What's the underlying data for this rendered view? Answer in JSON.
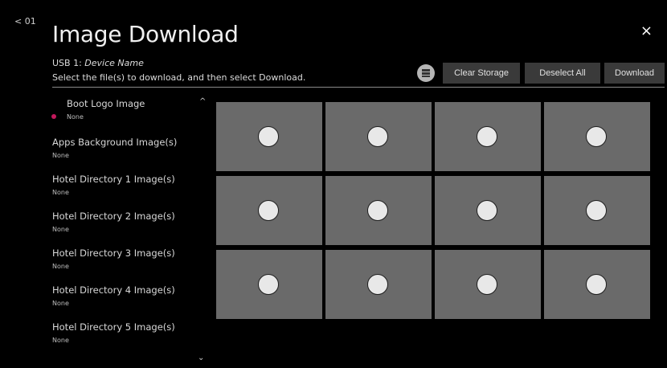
{
  "header": {
    "back_label": "< 01",
    "title": "Image Download",
    "close_glyph": "×",
    "usb_prefix": "USB 1: ",
    "usb_device": "Device Name",
    "instruction": "Select the file(s) to download, and then select Download."
  },
  "toolbar": {
    "storage_icon": "storage-icon",
    "clear_label": "Clear Storage",
    "deselect_label": "Deselect All",
    "download_label": "Download"
  },
  "sidebar": {
    "items": [
      {
        "label": "Boot Logo Image",
        "value": "None",
        "selected": true
      },
      {
        "label": "Apps Background Image(s)",
        "value": "None"
      },
      {
        "label": "Hotel Directory 1 Image(s)",
        "value": "None"
      },
      {
        "label": "Hotel Directory 2 Image(s)",
        "value": "None"
      },
      {
        "label": "Hotel Directory 3 Image(s)",
        "value": "None"
      },
      {
        "label": "Hotel Directory 4 Image(s)",
        "value": "None"
      },
      {
        "label": "Hotel Directory 5 Image(s)",
        "value": "None"
      }
    ],
    "scroll_up_glyph": "^",
    "scroll_down_glyph": "⌄"
  },
  "grid": {
    "rows": 3,
    "columns": 4,
    "tile_count": 12,
    "colors": {
      "tile": "#6a6a6a",
      "accent": "#c2185b"
    }
  }
}
